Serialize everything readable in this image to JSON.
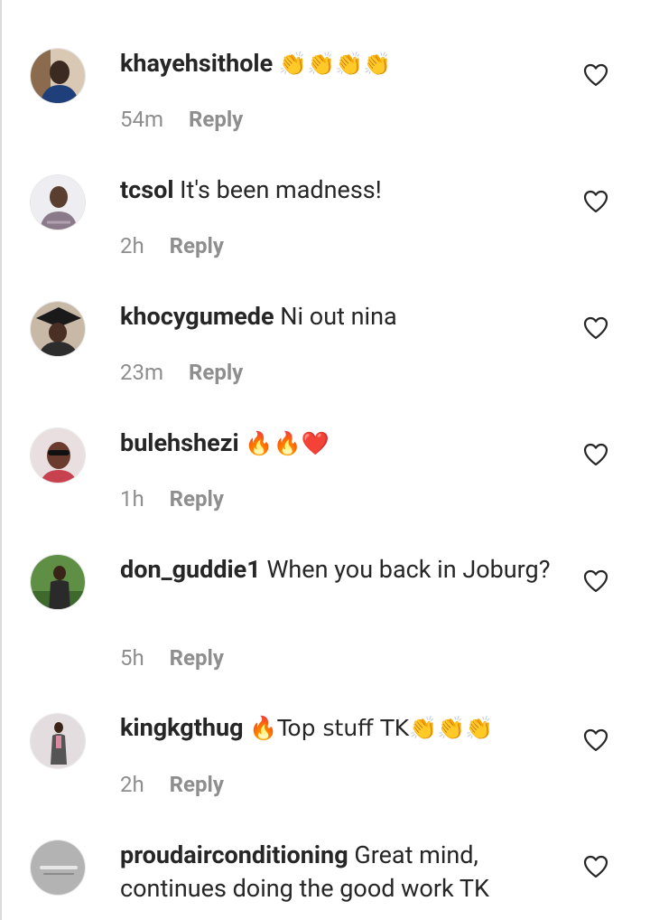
{
  "comments": [
    {
      "username": "khayehsithole",
      "text": "👏👏👏👏",
      "time": "54m",
      "reply_label": "Reply",
      "avatar_bg": "#8c7a6a"
    },
    {
      "username": "tcsol",
      "text": "It's been madness!",
      "time": "2h",
      "reply_label": "Reply",
      "avatar_bg": "#e9e9ee"
    },
    {
      "username": "khocygumede",
      "text": "Ni out nina",
      "time": "23m",
      "reply_label": "Reply",
      "avatar_bg": "#3a3330"
    },
    {
      "username": "bulehshezi",
      "text": "🔥🔥❤️",
      "time": "1h",
      "reply_label": "Reply",
      "avatar_bg": "#b05a66"
    },
    {
      "username": "don_guddie1",
      "text": "When you back in Joburg?",
      "time": "5h",
      "reply_label": "Reply",
      "avatar_bg": "#4e7a3a"
    },
    {
      "username": "kingkgthug",
      "text": "🔥Top stuff TK👏👏👏",
      "time": "2h",
      "reply_label": "Reply",
      "avatar_bg": "#dcd6d8"
    },
    {
      "username": "proudairconditioning",
      "text": "Great mind, continues doing the good work TK",
      "time": "",
      "reply_label": "",
      "avatar_bg": "#a9a9a9"
    }
  ],
  "colors": {
    "text": "#262626",
    "meta": "#8e8e8e",
    "fire": "#f57c00",
    "heart_emoji": "#e0102a",
    "clap": "#f6c12b"
  },
  "icons": {
    "like": "heart-outline-icon"
  }
}
